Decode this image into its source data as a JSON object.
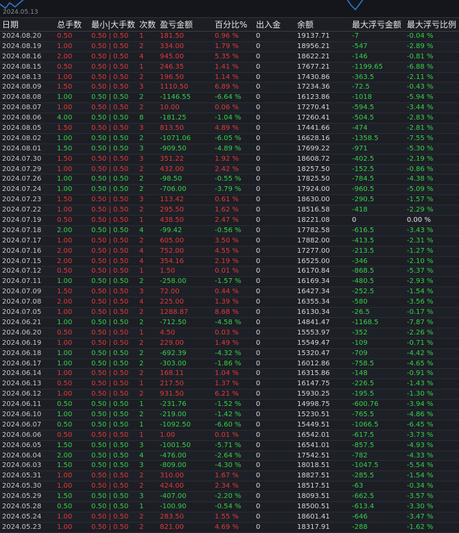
{
  "chart_strip": {
    "date_label": "2024.05.13",
    "line_color": "#2f7fe0"
  },
  "headers": {
    "date": "日期",
    "total_lots": "总手数",
    "min_max_lots": "最小|大手数",
    "count": "次数",
    "profit_loss": "盈亏金额",
    "percent": "百分比%",
    "deposit": "出入金",
    "balance": "余额",
    "max_float_loss_amount": "最大浮亏金额",
    "max_float_loss_ratio": "最大浮亏比例"
  },
  "colors": {
    "profit": "#e23a3a",
    "loss": "#36d24a",
    "neutral": "#e6e6e6"
  },
  "rows": [
    {
      "date": "2024.08.20",
      "total": "0.50",
      "minmax": "0.50 | 0.50",
      "count": "1",
      "pl": "181.50",
      "pct": "0.96 %",
      "dep": "0",
      "bal": "19137.71",
      "maxamt": "-7",
      "maxpct": "-0.04 %",
      "tone": "red"
    },
    {
      "date": "2024.08.19",
      "total": "1.00",
      "minmax": "0.50 | 0.50",
      "count": "2",
      "pl": "334.00",
      "pct": "1.79 %",
      "dep": "0",
      "bal": "18956.21",
      "maxamt": "-547",
      "maxpct": "-2.89 %",
      "tone": "red"
    },
    {
      "date": "2024.08.16",
      "total": "2.00",
      "minmax": "0.50 | 0.50",
      "count": "4",
      "pl": "945.00",
      "pct": "5.35 %",
      "dep": "0",
      "bal": "18622.21",
      "maxamt": "-146",
      "maxpct": "-0.81 %",
      "tone": "red"
    },
    {
      "date": "2024.08.15",
      "total": "0.50",
      "minmax": "0.50 | 0.50",
      "count": "1",
      "pl": "246.35",
      "pct": "1.41 %",
      "dep": "0",
      "bal": "17677.21",
      "maxamt": "-1199.65",
      "maxpct": "-6.88 %",
      "tone": "red"
    },
    {
      "date": "2024.08.13",
      "total": "1.00",
      "minmax": "0.50 | 0.50",
      "count": "2",
      "pl": "196.50",
      "pct": "1.14 %",
      "dep": "0",
      "bal": "17430.86",
      "maxamt": "-363.5",
      "maxpct": "-2.11 %",
      "tone": "red"
    },
    {
      "date": "2024.08.09",
      "total": "1.50",
      "minmax": "0.50 | 0.50",
      "count": "3",
      "pl": "1110.50",
      "pct": "6.89 %",
      "dep": "0",
      "bal": "17234.36",
      "maxamt": "-72.5",
      "maxpct": "-0.43 %",
      "tone": "red"
    },
    {
      "date": "2024.08.08",
      "total": "1.00",
      "minmax": "0.50 | 0.50",
      "count": "2",
      "pl": "-1146.55",
      "pct": "-6.64 %",
      "dep": "0",
      "bal": "16123.86",
      "maxamt": "-1018",
      "maxpct": "-5.94 %",
      "tone": "green"
    },
    {
      "date": "2024.08.07",
      "total": "1.00",
      "minmax": "0.50 | 0.50",
      "count": "2",
      "pl": "10.00",
      "pct": "0.06 %",
      "dep": "0",
      "bal": "17270.41",
      "maxamt": "-594.5",
      "maxpct": "-3.44 %",
      "tone": "red"
    },
    {
      "date": "2024.08.06",
      "total": "4.00",
      "minmax": "0.50 | 0.50",
      "count": "8",
      "pl": "-181.25",
      "pct": "-1.04 %",
      "dep": "0",
      "bal": "17260.41",
      "maxamt": "-504.5",
      "maxpct": "-2.83 %",
      "tone": "green"
    },
    {
      "date": "2024.08.05",
      "total": "1.50",
      "minmax": "0.50 | 0.50",
      "count": "3",
      "pl": "813.50",
      "pct": "4.89 %",
      "dep": "0",
      "bal": "17441.66",
      "maxamt": "-474",
      "maxpct": "-2.81 %",
      "tone": "red"
    },
    {
      "date": "2024.08.02",
      "total": "1.00",
      "minmax": "0.50 | 0.50",
      "count": "2",
      "pl": "-1071.06",
      "pct": "-6.05 %",
      "dep": "0",
      "bal": "16628.16",
      "maxamt": "-1358.5",
      "maxpct": "-7.55 %",
      "tone": "green"
    },
    {
      "date": "2024.08.01",
      "total": "1.50",
      "minmax": "0.50 | 0.50",
      "count": "3",
      "pl": "-909.50",
      "pct": "-4.89 %",
      "dep": "0",
      "bal": "17699.22",
      "maxamt": "-971",
      "maxpct": "-5.30 %",
      "tone": "green"
    },
    {
      "date": "2024.07.30",
      "total": "1.50",
      "minmax": "0.50 | 0.50",
      "count": "3",
      "pl": "351.22",
      "pct": "1.92 %",
      "dep": "0",
      "bal": "18608.72",
      "maxamt": "-402.5",
      "maxpct": "-2.19 %",
      "tone": "red"
    },
    {
      "date": "2024.07.29",
      "total": "1.00",
      "minmax": "0.50 | 0.50",
      "count": "2",
      "pl": "432.00",
      "pct": "2.42 %",
      "dep": "0",
      "bal": "18257.50",
      "maxamt": "-152.5",
      "maxpct": "-0.86 %",
      "tone": "red"
    },
    {
      "date": "2024.07.26",
      "total": "1.00",
      "minmax": "0.50 | 0.50",
      "count": "2",
      "pl": "-98.50",
      "pct": "-0.55 %",
      "dep": "0",
      "bal": "17825.50",
      "maxamt": "-784.5",
      "maxpct": "-4.38 %",
      "tone": "green"
    },
    {
      "date": "2024.07.24",
      "total": "1.00",
      "minmax": "0.50 | 0.50",
      "count": "2",
      "pl": "-706.00",
      "pct": "-3.79 %",
      "dep": "0",
      "bal": "17924.00",
      "maxamt": "-960.5",
      "maxpct": "-5.09 %",
      "tone": "green"
    },
    {
      "date": "2024.07.23",
      "total": "1.50",
      "minmax": "0.50 | 0.50",
      "count": "3",
      "pl": "113.42",
      "pct": "0.61 %",
      "dep": "0",
      "bal": "18630.00",
      "maxamt": "-290.5",
      "maxpct": "-1.57 %",
      "tone": "red"
    },
    {
      "date": "2024.07.22",
      "total": "1.00",
      "minmax": "0.50 | 0.50",
      "count": "2",
      "pl": "295.50",
      "pct": "1.62 %",
      "dep": "0",
      "bal": "18516.58",
      "maxamt": "-418",
      "maxpct": "-2.29 %",
      "tone": "red"
    },
    {
      "date": "2024.07.19",
      "total": "0.50",
      "minmax": "0.50 | 0.50",
      "count": "1",
      "pl": "438.50",
      "pct": "2.47 %",
      "dep": "0",
      "bal": "18221.08",
      "maxamt": "0",
      "maxpct": "0.00 %",
      "tone": "red",
      "max_tone": "white"
    },
    {
      "date": "2024.07.18",
      "total": "2.00",
      "minmax": "0.50 | 0.50",
      "count": "4",
      "pl": "-99.42",
      "pct": "-0.56 %",
      "dep": "0",
      "bal": "17782.58",
      "maxamt": "-616.5",
      "maxpct": "-3.43 %",
      "tone": "green"
    },
    {
      "date": "2024.07.17",
      "total": "1.00",
      "minmax": "0.50 | 0.50",
      "count": "2",
      "pl": "605.00",
      "pct": "3.50 %",
      "dep": "0",
      "bal": "17882.00",
      "maxamt": "-413.5",
      "maxpct": "-2.31 %",
      "tone": "red"
    },
    {
      "date": "2024.07.16",
      "total": "2.00",
      "minmax": "0.50 | 0.50",
      "count": "4",
      "pl": "752.00",
      "pct": "4.55 %",
      "dep": "0",
      "bal": "17277.00",
      "maxamt": "-213.5",
      "maxpct": "-1.27 %",
      "tone": "red"
    },
    {
      "date": "2024.07.15",
      "total": "2.00",
      "minmax": "0.50 | 0.50",
      "count": "4",
      "pl": "354.16",
      "pct": "2.19 %",
      "dep": "0",
      "bal": "16525.00",
      "maxamt": "-346",
      "maxpct": "-2.10 %",
      "tone": "red"
    },
    {
      "date": "2024.07.12",
      "total": "0.50",
      "minmax": "0.50 | 0.50",
      "count": "1",
      "pl": "1.50",
      "pct": "0.01 %",
      "dep": "0",
      "bal": "16170.84",
      "maxamt": "-868.5",
      "maxpct": "-5.37 %",
      "tone": "red"
    },
    {
      "date": "2024.07.11",
      "total": "1.00",
      "minmax": "0.50 | 0.50",
      "count": "2",
      "pl": "-258.00",
      "pct": "-1.57 %",
      "dep": "0",
      "bal": "16169.34",
      "maxamt": "-480.5",
      "maxpct": "-2.93 %",
      "tone": "green"
    },
    {
      "date": "2024.07.09",
      "total": "1.50",
      "minmax": "0.50 | 0.50",
      "count": "3",
      "pl": "72.00",
      "pct": "0.44 %",
      "dep": "0",
      "bal": "16427.34",
      "maxamt": "-252.5",
      "maxpct": "-1.54 %",
      "tone": "red"
    },
    {
      "date": "2024.07.08",
      "total": "2.00",
      "minmax": "0.50 | 0.50",
      "count": "4",
      "pl": "225.00",
      "pct": "1.39 %",
      "dep": "0",
      "bal": "16355.34",
      "maxamt": "-580",
      "maxpct": "-3.56 %",
      "tone": "red"
    },
    {
      "date": "2024.07.05",
      "total": "1.00",
      "minmax": "0.50 | 0.50",
      "count": "2",
      "pl": "1288.87",
      "pct": "8.68 %",
      "dep": "0",
      "bal": "16130.34",
      "maxamt": "-26.5",
      "maxpct": "-0.17 %",
      "tone": "red"
    },
    {
      "date": "2024.06.21",
      "total": "1.00",
      "minmax": "0.50 | 0.50",
      "count": "2",
      "pl": "-712.50",
      "pct": "-4.58 %",
      "dep": "0",
      "bal": "14841.47",
      "maxamt": "-1168.5",
      "maxpct": "-7.87 %",
      "tone": "green"
    },
    {
      "date": "2024.06.20",
      "total": "0.50",
      "minmax": "0.50 | 0.50",
      "count": "1",
      "pl": "4.50",
      "pct": "0.03 %",
      "dep": "0",
      "bal": "15553.97",
      "maxamt": "-352",
      "maxpct": "-2.26 %",
      "tone": "red"
    },
    {
      "date": "2024.06.19",
      "total": "1.00",
      "minmax": "0.50 | 0.50",
      "count": "2",
      "pl": "229.00",
      "pct": "1.49 %",
      "dep": "0",
      "bal": "15549.47",
      "maxamt": "-109",
      "maxpct": "-0.71 %",
      "tone": "red"
    },
    {
      "date": "2024.06.18",
      "total": "1.00",
      "minmax": "0.50 | 0.50",
      "count": "2",
      "pl": "-692.39",
      "pct": "-4.32 %",
      "dep": "0",
      "bal": "15320.47",
      "maxamt": "-709",
      "maxpct": "-4.42 %",
      "tone": "green"
    },
    {
      "date": "2024.06.17",
      "total": "1.00",
      "minmax": "0.50 | 0.50",
      "count": "2",
      "pl": "-303.00",
      "pct": "-1.86 %",
      "dep": "0",
      "bal": "16012.86",
      "maxamt": "-758.5",
      "maxpct": "-4.65 %",
      "tone": "green"
    },
    {
      "date": "2024.06.14",
      "total": "1.00",
      "minmax": "0.50 | 0.50",
      "count": "2",
      "pl": "168.11",
      "pct": "1.04 %",
      "dep": "0",
      "bal": "16315.86",
      "maxamt": "-148",
      "maxpct": "-0.91 %",
      "tone": "red"
    },
    {
      "date": "2024.06.13",
      "total": "0.50",
      "minmax": "0.50 | 0.50",
      "count": "1",
      "pl": "217.50",
      "pct": "1.37 %",
      "dep": "0",
      "bal": "16147.75",
      "maxamt": "-226.5",
      "maxpct": "-1.43 %",
      "tone": "red"
    },
    {
      "date": "2024.06.12",
      "total": "1.00",
      "minmax": "0.50 | 0.50",
      "count": "2",
      "pl": "931.50",
      "pct": "6.21 %",
      "dep": "0",
      "bal": "15930.25",
      "maxamt": "-195.5",
      "maxpct": "-1.30 %",
      "tone": "red"
    },
    {
      "date": "2024.06.11",
      "total": "0.50",
      "minmax": "0.50 | 0.50",
      "count": "1",
      "pl": "-231.76",
      "pct": "-1.52 %",
      "dep": "0",
      "bal": "14998.75",
      "maxamt": "-600.76",
      "maxpct": "-3.94 %",
      "tone": "green"
    },
    {
      "date": "2024.06.10",
      "total": "1.00",
      "minmax": "0.50 | 0.50",
      "count": "2",
      "pl": "-219.00",
      "pct": "-1.42 %",
      "dep": "0",
      "bal": "15230.51",
      "maxamt": "-765.5",
      "maxpct": "-4.86 %",
      "tone": "green"
    },
    {
      "date": "2024.06.07",
      "total": "0.50",
      "minmax": "0.50 | 0.50",
      "count": "1",
      "pl": "-1092.50",
      "pct": "-6.60 %",
      "dep": "0",
      "bal": "15449.51",
      "maxamt": "-1066.5",
      "maxpct": "-6.45 %",
      "tone": "green"
    },
    {
      "date": "2024.06.06",
      "total": "0.50",
      "minmax": "0.50 | 0.50",
      "count": "1",
      "pl": "1.00",
      "pct": "0.01 %",
      "dep": "0",
      "bal": "16542.01",
      "maxamt": "-617.5",
      "maxpct": "-3.73 %",
      "tone": "red"
    },
    {
      "date": "2024.06.05",
      "total": "1.50",
      "minmax": "0.50 | 0.50",
      "count": "3",
      "pl": "-1001.50",
      "pct": "-5.71 %",
      "dep": "0",
      "bal": "16541.01",
      "maxamt": "-857.5",
      "maxpct": "-4.93 %",
      "tone": "green"
    },
    {
      "date": "2024.06.04",
      "total": "2.00",
      "minmax": "0.50 | 0.50",
      "count": "4",
      "pl": "-476.00",
      "pct": "-2.64 %",
      "dep": "0",
      "bal": "17542.51",
      "maxamt": "-782",
      "maxpct": "-4.33 %",
      "tone": "green"
    },
    {
      "date": "2024.06.03",
      "total": "1.50",
      "minmax": "0.50 | 0.50",
      "count": "3",
      "pl": "-809.00",
      "pct": "-4.30 %",
      "dep": "0",
      "bal": "18018.51",
      "maxamt": "-1047.5",
      "maxpct": "-5.54 %",
      "tone": "green"
    },
    {
      "date": "2024.05.31",
      "total": "1.00",
      "minmax": "0.50 | 0.50",
      "count": "2",
      "pl": "310.00",
      "pct": "1.67 %",
      "dep": "0",
      "bal": "18827.51",
      "maxamt": "-285.5",
      "maxpct": "-1.54 %",
      "tone": "red"
    },
    {
      "date": "2024.05.30",
      "total": "1.00",
      "minmax": "0.50 | 0.50",
      "count": "2",
      "pl": "424.00",
      "pct": "2.34 %",
      "dep": "0",
      "bal": "18517.51",
      "maxamt": "-63",
      "maxpct": "-0.34 %",
      "tone": "red"
    },
    {
      "date": "2024.05.29",
      "total": "1.50",
      "minmax": "0.50 | 0.50",
      "count": "3",
      "pl": "-407.00",
      "pct": "-2.20 %",
      "dep": "0",
      "bal": "18093.51",
      "maxamt": "-662.5",
      "maxpct": "-3.57 %",
      "tone": "green"
    },
    {
      "date": "2024.05.28",
      "total": "0.50",
      "minmax": "0.50 | 0.50",
      "count": "1",
      "pl": "-100.90",
      "pct": "-0.54 %",
      "dep": "0",
      "bal": "18500.51",
      "maxamt": "-613.4",
      "maxpct": "-3.30 %",
      "tone": "green"
    },
    {
      "date": "2024.05.24",
      "total": "1.00",
      "minmax": "0.50 | 0.50",
      "count": "2",
      "pl": "283.50",
      "pct": "1.55 %",
      "dep": "0",
      "bal": "18601.41",
      "maxamt": "-646",
      "maxpct": "-3.47 %",
      "tone": "red"
    },
    {
      "date": "2024.05.23",
      "total": "1.00",
      "minmax": "0.50 | 0.50",
      "count": "2",
      "pl": "821.00",
      "pct": "4.69 %",
      "dep": "0",
      "bal": "18317.91",
      "maxamt": "-288",
      "maxpct": "-1.62 %",
      "tone": "red"
    }
  ]
}
